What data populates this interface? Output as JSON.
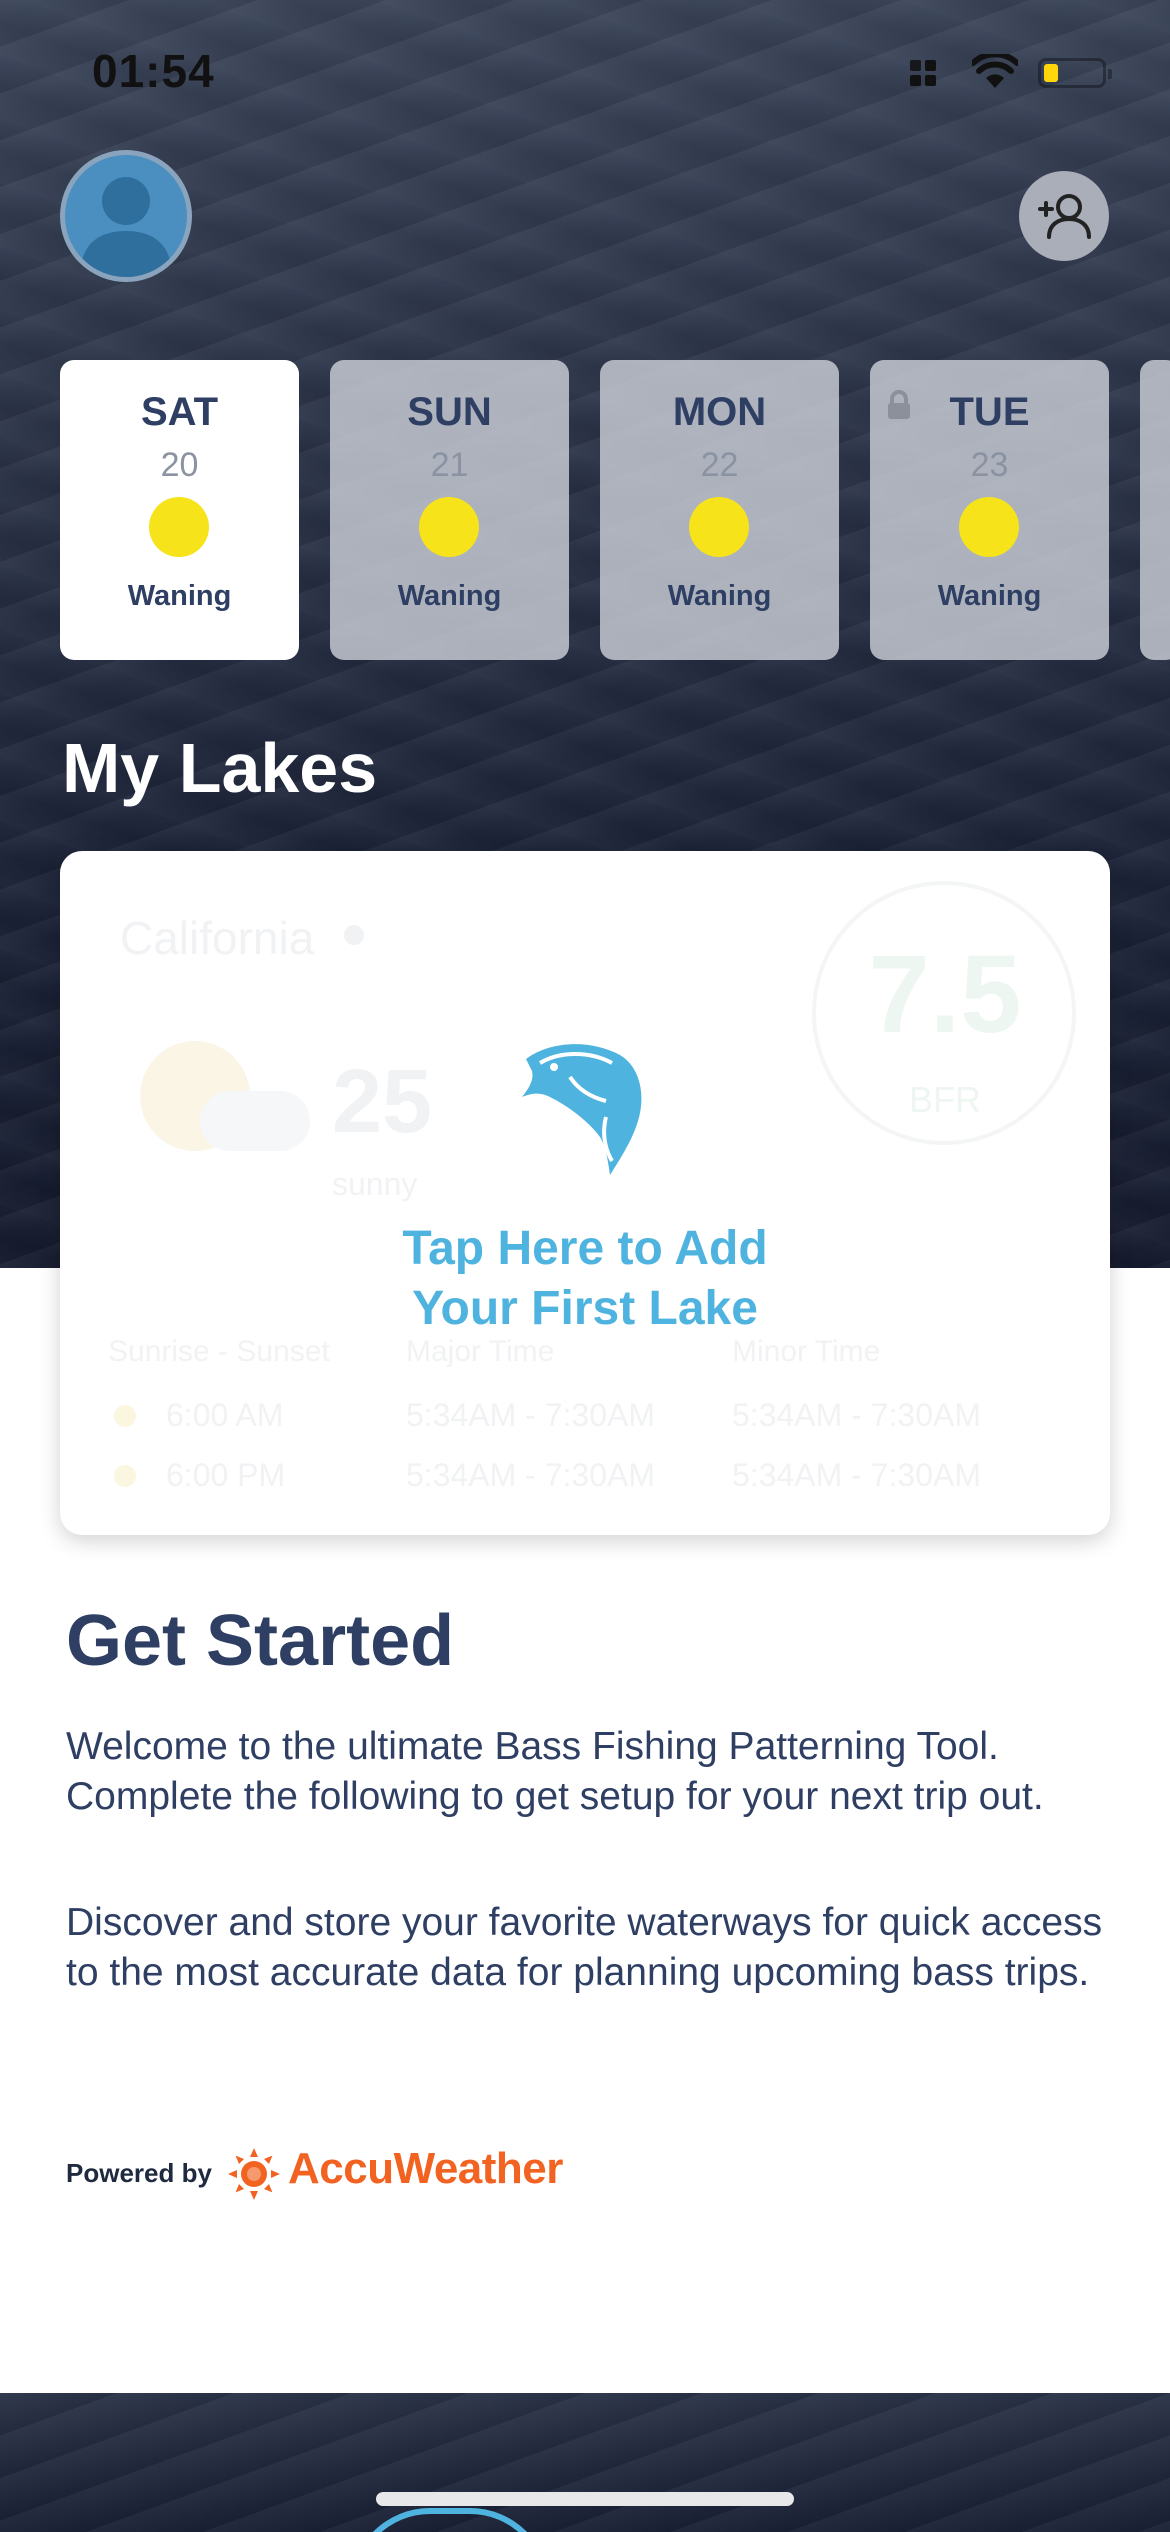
{
  "status_bar": {
    "time": "01:54"
  },
  "days": [
    {
      "name": "SAT",
      "num": "20",
      "phase": "Waning",
      "active": true,
      "locked": false
    },
    {
      "name": "SUN",
      "num": "21",
      "phase": "Waning",
      "active": false,
      "locked": false
    },
    {
      "name": "MON",
      "num": "22",
      "phase": "Waning",
      "active": false,
      "locked": false
    },
    {
      "name": "TUE",
      "num": "23",
      "phase": "Waning",
      "active": false,
      "locked": true
    }
  ],
  "my_lakes": {
    "title": "My Lakes",
    "cta_line1": "Tap Here to Add",
    "cta_line2": "Your First Lake",
    "placeholder": {
      "place": "California",
      "temp": "25",
      "condition": "sunny",
      "score": "7.5",
      "score_unit": "BFR",
      "headers": [
        "Sunrise - Sunset",
        "Major Time",
        "Minor Time"
      ],
      "rows": [
        {
          "sun": "6:00 AM",
          "major": "5:34AM - 7:30AM",
          "minor": "5:34AM - 7:30AM"
        },
        {
          "sun": "6:00 PM",
          "major": "5:34AM - 7:30AM",
          "minor": "5:34AM - 7:30AM"
        }
      ]
    }
  },
  "get_started": {
    "title": "Get Started",
    "para1": "Welcome to the ultimate Bass Fishing Patterning Tool. Complete the following to get setup for your next trip out.",
    "para2": "Discover and store your favorite waterways for quick access to the most accurate data for planning upcoming bass trips."
  },
  "footer": {
    "powered_by": "Powered by",
    "brand": "AccuWeather",
    "brand_color": "#f26322"
  },
  "colors": {
    "accent": "#4fb3df",
    "navy": "#2e3f63",
    "moon": "#f6e31a"
  }
}
